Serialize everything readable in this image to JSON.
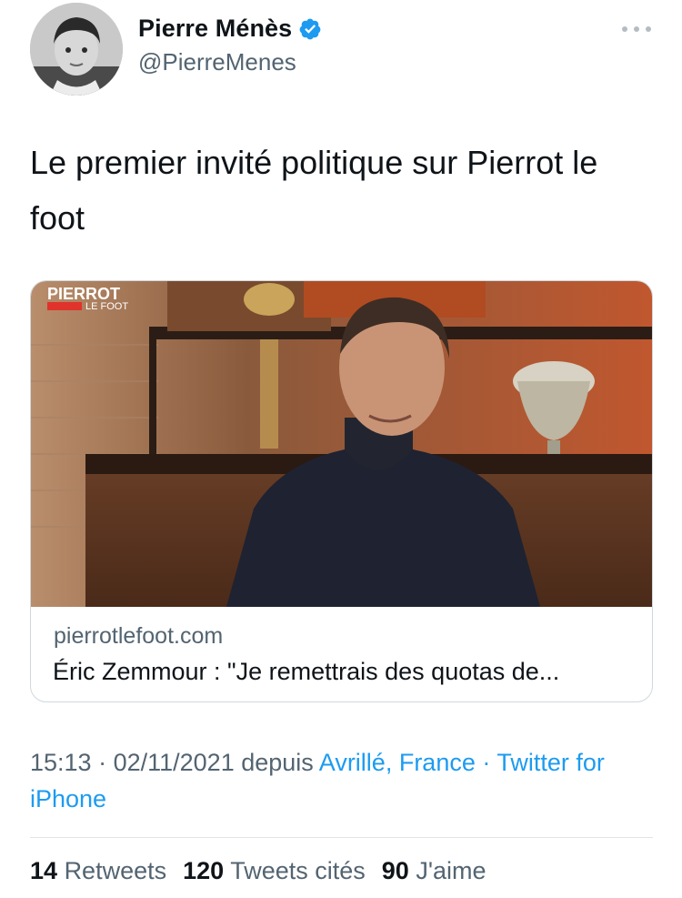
{
  "author": {
    "name": "Pierre Ménès",
    "handle": "@PierreMenes",
    "verified": true,
    "avatar_icon": "portrait-avatar"
  },
  "tweet": {
    "text": "Le premier invité politique sur Pierrot le foot"
  },
  "card": {
    "logo_line1": "PIERROT",
    "logo_line2": "LE FOOT",
    "domain": "pierrotlefoot.com",
    "title": "Éric Zemmour : \"Je remettrais des quotas de..."
  },
  "meta": {
    "time": "15:13",
    "separator1": " · ",
    "date": "02/11/2021",
    "depuis": " depuis ",
    "location": "Avrillé, France",
    "separator2": " · ",
    "source": "Twitter for iPhone"
  },
  "stats": {
    "retweets_count": "14",
    "retweets_label": "Retweets",
    "quotes_count": "120",
    "quotes_label": "Tweets cités",
    "likes_count": "90",
    "likes_label": "J'aime"
  },
  "colors": {
    "accent": "#1d9bf0",
    "text": "#0f1419",
    "secondary": "#536471"
  }
}
